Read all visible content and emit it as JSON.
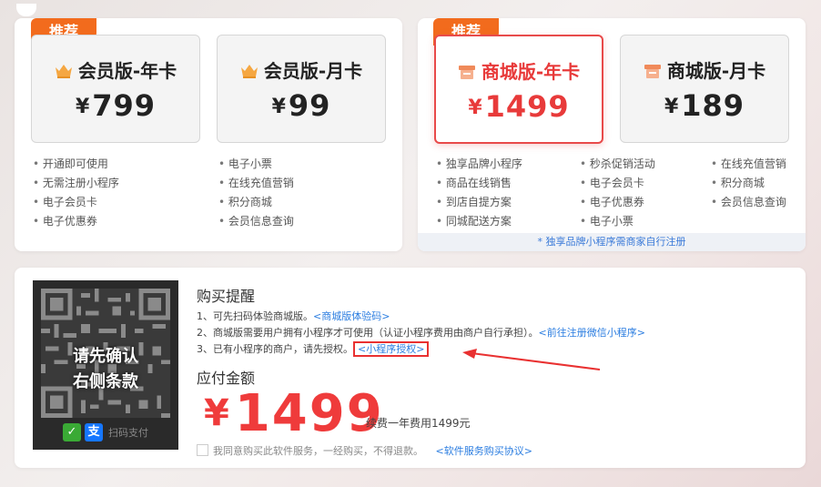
{
  "member_panel": {
    "badge": "推荐",
    "plans": [
      {
        "title": "会员版-年卡",
        "price": "799",
        "currency": "¥",
        "icon": "crown-icon"
      },
      {
        "title": "会员版-月卡",
        "price": "99",
        "currency": "¥",
        "icon": "crown-icon"
      }
    ],
    "features_col1": [
      "开通即可使用",
      "无需注册小程序",
      "电子会员卡",
      "电子优惠券"
    ],
    "features_col2": [
      "电子小票",
      "在线充值营销",
      "积分商城",
      "会员信息查询"
    ]
  },
  "shop_panel": {
    "badge": "推荐",
    "plans": [
      {
        "title": "商城版-年卡",
        "price": "1499",
        "currency": "¥",
        "icon": "shop-icon",
        "selected": true
      },
      {
        "title": "商城版-月卡",
        "price": "189",
        "currency": "¥",
        "icon": "shop-icon"
      }
    ],
    "features_col1": [
      "独享品牌小程序",
      "商品在线销售",
      "到店自提方案",
      "同城配送方案"
    ],
    "features_col2": [
      "秒杀促销活动",
      "电子会员卡",
      "电子优惠券",
      "电子小票"
    ],
    "features_col3": [
      "在线充值营销",
      "积分商城",
      "会员信息查询"
    ],
    "note": "* 独享品牌小程序需商家自行注册"
  },
  "purchase": {
    "qr_overlay_line1": "请先确认",
    "qr_overlay_line2": "右侧条款",
    "qr_footer_label": "扫码支付",
    "reminder_title": "购买提醒",
    "tip1_text": "1、可先扫码体验商城版。",
    "tip1_link": "<商城版体验码>",
    "tip2_text": "2、商城版需要用户拥有小程序才可使用（认证小程序费用由商户自行承担）。",
    "tip2_link": "<前往注册微信小程序>",
    "tip3_text": "3、已有小程序的商户，请先授权。",
    "tip3_link": "<小程序授权>",
    "amount_title": "应付金额",
    "amount_currency": "¥",
    "amount_value": "1499",
    "renew_text": "续费一年费用1499元",
    "agree_text": "我同意购买此软件服务，一经购买，不得退款。",
    "agree_link": "<软件服务购买协议>"
  },
  "colors": {
    "accent_red": "#e83a3a",
    "badge_orange": "#f26b1d",
    "link_blue": "#2b7de0"
  }
}
